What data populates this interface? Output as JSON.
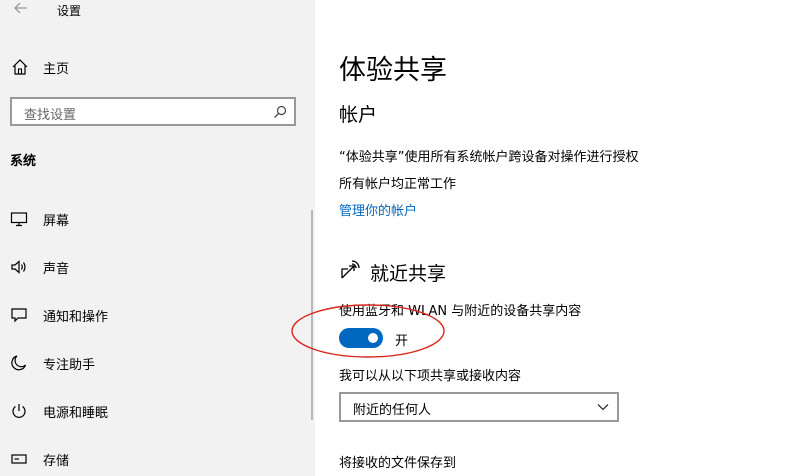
{
  "app": {
    "title": "设置"
  },
  "sidebar": {
    "home_label": "主页",
    "search_placeholder": "查找设置",
    "section_title": "系统",
    "items": [
      {
        "label": "屏幕",
        "icon": "monitor-icon"
      },
      {
        "label": "声音",
        "icon": "speaker-icon"
      },
      {
        "label": "通知和操作",
        "icon": "message-icon"
      },
      {
        "label": "专注助手",
        "icon": "moon-icon"
      },
      {
        "label": "电源和睡眠",
        "icon": "power-icon"
      },
      {
        "label": "存储",
        "icon": "storage-icon"
      }
    ]
  },
  "main": {
    "page_title": "体验共享",
    "accounts": {
      "heading": "帐户",
      "description": "“体验共享”使用所有系统帐户跨设备对操作进行授权",
      "status": "所有帐户均正常工作",
      "manage_link": "管理你的帐户"
    },
    "nearby": {
      "heading": "就近共享",
      "toggle_description": "使用蓝牙和 WLAN 与附近的设备共享内容",
      "toggle_on": true,
      "toggle_state_label": "开",
      "receive_label": "我可以从以下项共享或接收内容",
      "receive_selected": "附近的任何人",
      "save_to_label": "将接收的文件保存到"
    }
  },
  "colors": {
    "accent": "#0067c0",
    "sidebar_bg": "#f2f2f2",
    "annotation": "#d9261c"
  }
}
